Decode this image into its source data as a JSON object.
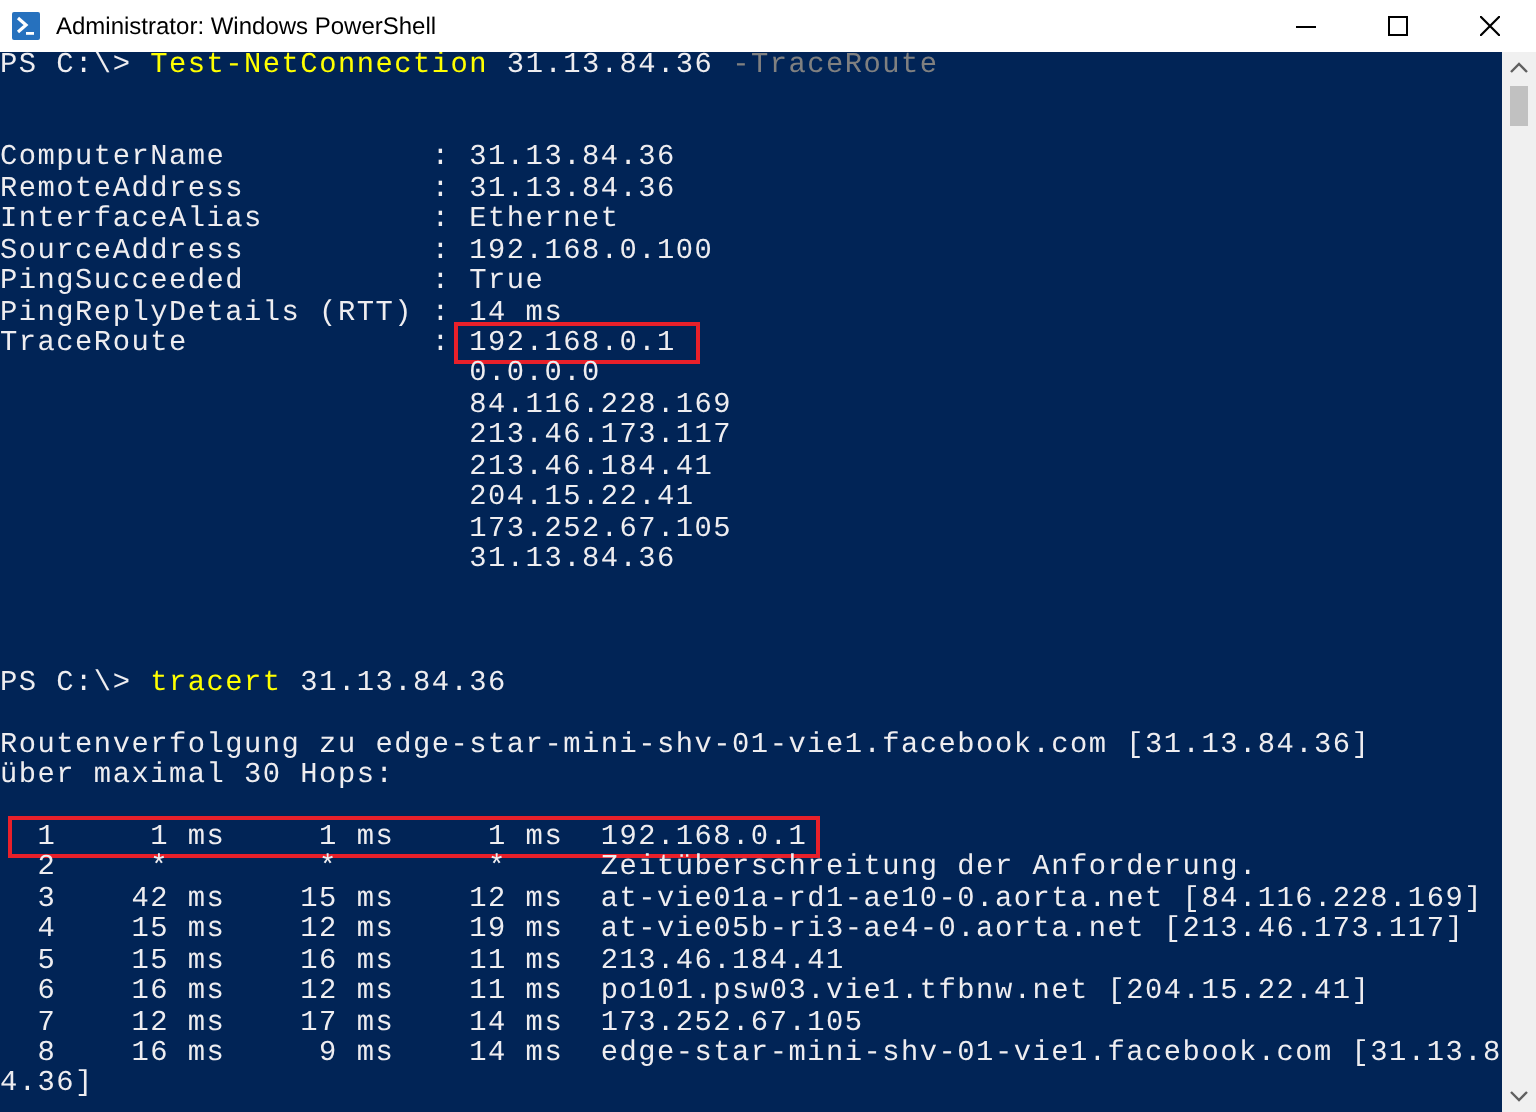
{
  "window": {
    "title": "Administrator: Windows PowerShell"
  },
  "console": {
    "lines": [
      {
        "kind": "text",
        "segments": [
          {
            "kind": "prompt",
            "text": "PS C:\\> "
          },
          {
            "kind": "command",
            "text": "Test-NetConnection"
          },
          {
            "kind": "argument",
            "text": " 31.13.84.36"
          },
          {
            "kind": "parameter",
            "text": " -TraceRoute"
          }
        ]
      },
      {
        "kind": "blank"
      },
      {
        "kind": "blank"
      },
      {
        "kind": "text",
        "segments": [
          {
            "kind": "output",
            "text": "ComputerName           : 31.13.84.36"
          }
        ]
      },
      {
        "kind": "text",
        "segments": [
          {
            "kind": "output",
            "text": "RemoteAddress          : 31.13.84.36"
          }
        ]
      },
      {
        "kind": "text",
        "segments": [
          {
            "kind": "output",
            "text": "InterfaceAlias         : Ethernet"
          }
        ]
      },
      {
        "kind": "text",
        "segments": [
          {
            "kind": "output",
            "text": "SourceAddress          : 192.168.0.100"
          }
        ]
      },
      {
        "kind": "text",
        "segments": [
          {
            "kind": "output",
            "text": "PingSucceeded          : True"
          }
        ]
      },
      {
        "kind": "text",
        "segments": [
          {
            "kind": "output",
            "text": "PingReplyDetails (RTT) : 14 ms"
          }
        ]
      },
      {
        "kind": "text",
        "segments": [
          {
            "kind": "output",
            "text": "TraceRoute             : "
          },
          {
            "kind": "output",
            "text": "192.168.0.1",
            "boxed": true
          }
        ]
      },
      {
        "kind": "text",
        "segments": [
          {
            "kind": "output",
            "text": "                         0.0.0.0"
          }
        ]
      },
      {
        "kind": "text",
        "segments": [
          {
            "kind": "output",
            "text": "                         84.116.228.169"
          }
        ]
      },
      {
        "kind": "text",
        "segments": [
          {
            "kind": "output",
            "text": "                         213.46.173.117"
          }
        ]
      },
      {
        "kind": "text",
        "segments": [
          {
            "kind": "output",
            "text": "                         213.46.184.41"
          }
        ]
      },
      {
        "kind": "text",
        "segments": [
          {
            "kind": "output",
            "text": "                         204.15.22.41"
          }
        ]
      },
      {
        "kind": "text",
        "segments": [
          {
            "kind": "output",
            "text": "                         173.252.67.105"
          }
        ]
      },
      {
        "kind": "text",
        "segments": [
          {
            "kind": "output",
            "text": "                         31.13.84.36"
          }
        ]
      },
      {
        "kind": "blank"
      },
      {
        "kind": "blank"
      },
      {
        "kind": "blank"
      },
      {
        "kind": "text",
        "segments": [
          {
            "kind": "prompt",
            "text": "PS C:\\> "
          },
          {
            "kind": "command",
            "text": "tracert"
          },
          {
            "kind": "argument",
            "text": " 31.13.84.36"
          }
        ]
      },
      {
        "kind": "blank"
      },
      {
        "kind": "text",
        "segments": [
          {
            "kind": "output",
            "text": "Routenverfolgung zu edge-star-mini-shv-01-vie1.facebook.com [31.13.84.36]"
          }
        ]
      },
      {
        "kind": "text",
        "segments": [
          {
            "kind": "output",
            "text": "über maximal 30 Hops:"
          }
        ]
      },
      {
        "kind": "blank"
      },
      {
        "kind": "text",
        "segments": [
          {
            "kind": "output",
            "text": "  1     1 ms     1 ms     1 ms  192.168.0.1",
            "boxed": true
          }
        ]
      },
      {
        "kind": "text",
        "segments": [
          {
            "kind": "output",
            "text": "  2     *        *        *     Zeitüberschreitung der Anforderung."
          }
        ]
      },
      {
        "kind": "text",
        "segments": [
          {
            "kind": "output",
            "text": "  3    42 ms    15 ms    12 ms  at-vie01a-rd1-ae10-0.aorta.net [84.116.228.169]"
          }
        ]
      },
      {
        "kind": "text",
        "segments": [
          {
            "kind": "output",
            "text": "  4    15 ms    12 ms    19 ms  at-vie05b-ri3-ae4-0.aorta.net [213.46.173.117]"
          }
        ]
      },
      {
        "kind": "text",
        "segments": [
          {
            "kind": "output",
            "text": "  5    15 ms    16 ms    11 ms  213.46.184.41"
          }
        ]
      },
      {
        "kind": "text",
        "segments": [
          {
            "kind": "output",
            "text": "  6    16 ms    12 ms    11 ms  po101.psw03.vie1.tfbnw.net [204.15.22.41]"
          }
        ]
      },
      {
        "kind": "text",
        "segments": [
          {
            "kind": "output",
            "text": "  7    12 ms    17 ms    14 ms  173.252.67.105"
          }
        ]
      },
      {
        "kind": "text",
        "segments": [
          {
            "kind": "output",
            "text": "  8    16 ms     9 ms    14 ms  edge-star-mini-shv-01-vie1.facebook.com [31.13.8"
          }
        ]
      },
      {
        "kind": "text",
        "segments": [
          {
            "kind": "output",
            "text": "4.36]"
          }
        ]
      }
    ]
  }
}
